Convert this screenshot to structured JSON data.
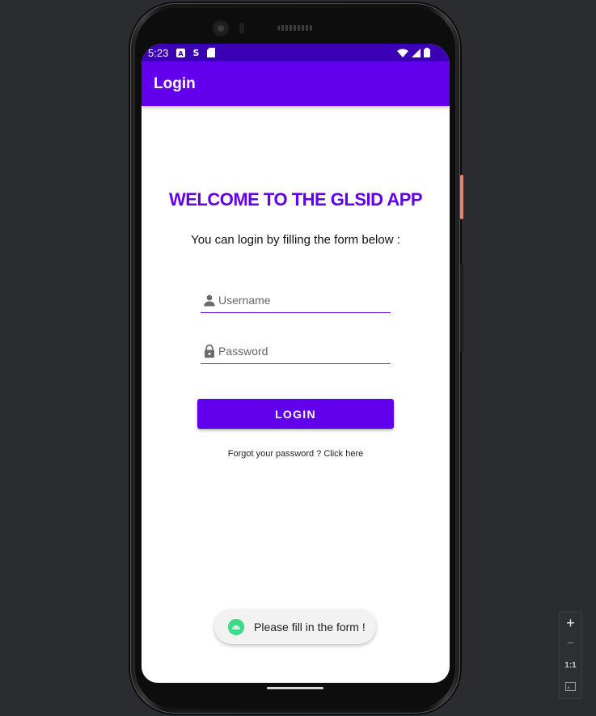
{
  "status_bar": {
    "time": "5:23",
    "icons": [
      "a-icon",
      "s-icon",
      "sd-card-icon"
    ],
    "right_icons": [
      "wifi-icon",
      "signal-icon",
      "battery-icon"
    ]
  },
  "app_bar": {
    "title": "Login"
  },
  "main": {
    "welcome": "WELCOME TO THE GLSID APP",
    "subtitle": "You can login by filling the form below :",
    "username_placeholder": "Username",
    "password_placeholder": "Password",
    "login_label": "LOGIN",
    "forgot_text": "Forgot your password ? Click here"
  },
  "toast": {
    "text": "Please fill in the form !"
  },
  "zoom": {
    "plus": "+",
    "minus": "−",
    "one_to_one": "1:1"
  },
  "colors": {
    "primary": "#6200ee",
    "status_bar": "#3b00b3",
    "toast_icon": "#3ddc84"
  }
}
